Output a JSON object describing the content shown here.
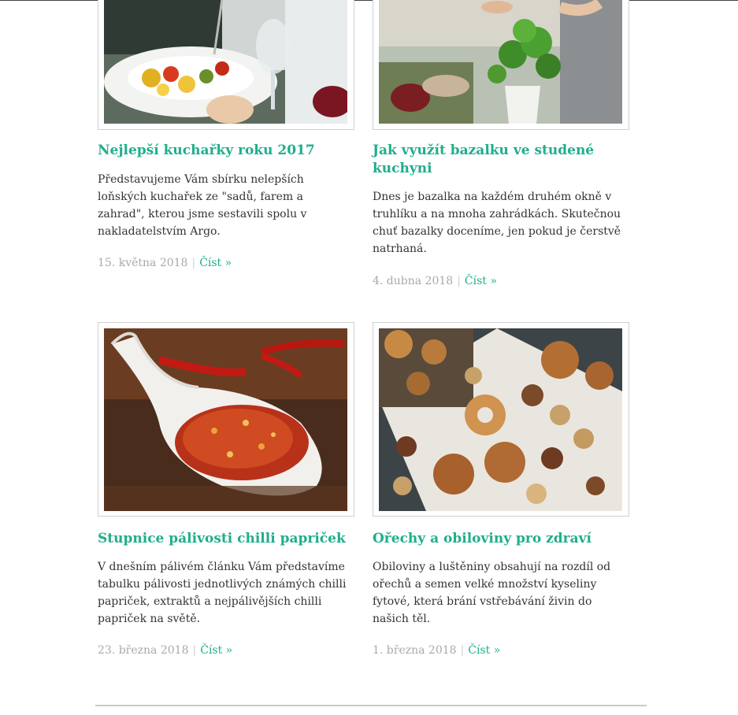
{
  "articles": [
    {
      "title": "Nejlepší kuchařky roku 2017",
      "description": "Představujeme Vám sbírku nelepších loňských kuchařek ze \"sadů, farem a zahrad\", kterou jsme sestavili spolu v nakladatelstvím Argo.",
      "date": "15. května 2018",
      "separator": "|",
      "read_more": "Číst »"
    },
    {
      "title": "Jak využít bazalku ve studené kuchyni",
      "description": "Dnes je bazalka na každém druhém okně v truhlíku a na mnoha zahrádkách. Skutečnou chuť bazalky doceníme, jen pokud je čerstvě natrhaná.",
      "date": "4. dubna 2018",
      "separator": "|",
      "read_more": "Číst »"
    },
    {
      "title": "Stupnice pálivosti chilli papriček",
      "description": "V dnešním pálivém článku Vám představíme tabulku pálivosti jednotlivých známých chilli papriček, extraktů a nejpálivějších chilli papriček na světě.",
      "date": "23. března 2018",
      "separator": "|",
      "read_more": "Číst »"
    },
    {
      "title": "Ořechy a obiloviny pro zdraví",
      "description": "Obiloviny a luštěniny obsahují na rozdíl od ořechů a semen velké množství kyseliny fytové, která brání vstřebávání živin do našich těl.",
      "date": "1. března 2018",
      "separator": "|",
      "read_more": "Číst »"
    }
  ],
  "colors": {
    "accent": "#1fae8c",
    "muted": "#a9a9a9",
    "text": "#333333"
  }
}
